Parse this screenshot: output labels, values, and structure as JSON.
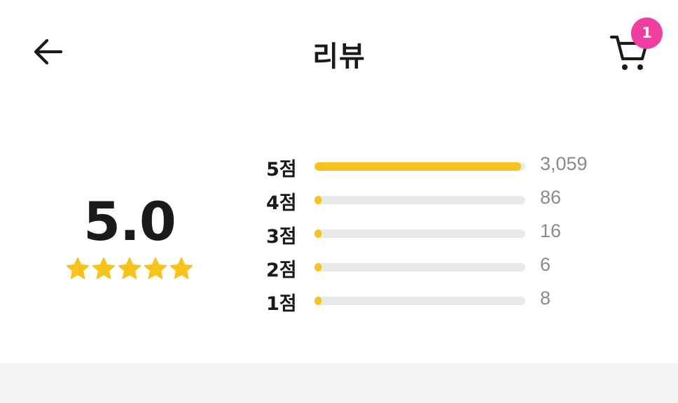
{
  "header": {
    "title": "리뷰",
    "cart_badge_count": "1",
    "back_icon": "arrow-left-icon",
    "cart_icon": "shopping-cart-icon"
  },
  "summary": {
    "average": "5.0",
    "stars_filled": 5,
    "stars_total": 5,
    "star_color": "#f6c21c"
  },
  "distribution": [
    {
      "label": "5점",
      "count": "3,059",
      "fraction": 0.9812
    },
    {
      "label": "4점",
      "count": "86",
      "fraction": 0.0276
    },
    {
      "label": "3점",
      "count": "16",
      "fraction": 0.0051
    },
    {
      "label": "2점",
      "count": "6",
      "fraction": 0.0019
    },
    {
      "label": "1점",
      "count": "8",
      "fraction": 0.0026
    }
  ],
  "colors": {
    "accent": "#f6c21c",
    "badge": "#ee3fa0",
    "track": "#e9e9e9",
    "count_text": "#8a8a8a",
    "divider": "#f3f4f4"
  }
}
